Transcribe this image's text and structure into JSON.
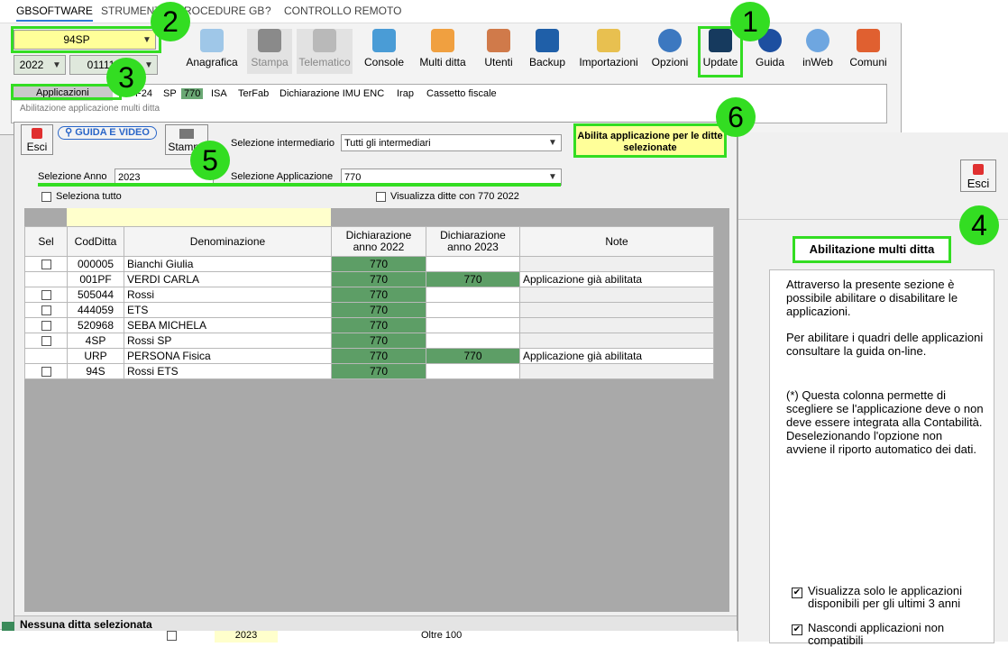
{
  "menu": [
    "GBSOFTWARE",
    "STRUMENTI",
    "PROCEDURE GB",
    "?",
    "CONTROLLO REMOTO"
  ],
  "company_select": "94SP",
  "year_select": "2022",
  "code_select": "011110/",
  "toolbar": [
    {
      "label": "Anagrafica",
      "icon": "user-card-icon",
      "disabled": false
    },
    {
      "label": "Stampa",
      "icon": "printer-icon",
      "disabled": true
    },
    {
      "label": "Telematico",
      "icon": "document-icon",
      "disabled": true
    },
    {
      "label": "Console",
      "icon": "console-icon",
      "disabled": false
    },
    {
      "label": "Multi ditta",
      "icon": "org-chart-icon",
      "disabled": false
    },
    {
      "label": "Utenti",
      "icon": "users-icon",
      "disabled": false
    },
    {
      "label": "Backup",
      "icon": "backup-icon",
      "disabled": false
    },
    {
      "label": "Importazioni",
      "icon": "import-icon",
      "disabled": false
    },
    {
      "label": "Opzioni",
      "icon": "gear-icon",
      "disabled": false
    },
    {
      "label": "Update",
      "icon": "monitor-icon",
      "disabled": false
    },
    {
      "label": "Guida",
      "icon": "help-icon",
      "disabled": false
    },
    {
      "label": "inWeb",
      "icon": "cloud-icon",
      "disabled": false
    },
    {
      "label": "Comuni",
      "icon": "megaphone-icon",
      "disabled": false
    }
  ],
  "nav_tabs": [
    "Applicazioni",
    "F24",
    "SP",
    "770",
    "ISA",
    "TerFab",
    "Dichiarazione IMU ENC",
    "Irap",
    "Cassetto fiscale"
  ],
  "window_caption": "Abilitazione applicazione multi ditta",
  "dialog": {
    "exit_label": "Esci",
    "guide_label": "GUIDA E VIDEO",
    "print_label": "Stampa",
    "intermediary_label": "Selezione intermediario",
    "intermediary_value": "Tutti gli intermediari",
    "enable_button": "Abilita applicazione per le ditte selezionate",
    "year_label": "Selezione Anno",
    "year_value": "2023",
    "app_label": "Selezione Applicazione",
    "app_value": "770",
    "select_all": "Seleziona tutto",
    "show_companies": "Visualizza ditte con 770 2022",
    "columns": [
      "Sel",
      "CodDitta",
      "Denominazione",
      "Dichiarazione anno 2022",
      "Dichiarazione anno 2023",
      "Note"
    ],
    "rows": [
      {
        "sel": true,
        "code": "000005",
        "name": "Bianchi Giulia",
        "y2022": "770",
        "y2023": "",
        "note": ""
      },
      {
        "sel": false,
        "code": "001PF",
        "name": "VERDI CARLA",
        "y2022": "770",
        "y2023": "770",
        "note": "Applicazione già abilitata"
      },
      {
        "sel": true,
        "code": "505044",
        "name": "Rossi",
        "y2022": "770",
        "y2023": "",
        "note": ""
      },
      {
        "sel": true,
        "code": "444059",
        "name": "ETS",
        "y2022": "770",
        "y2023": "",
        "note": ""
      },
      {
        "sel": true,
        "code": "520968",
        "name": "SEBA MICHELA",
        "y2022": "770",
        "y2023": "",
        "note": ""
      },
      {
        "sel": true,
        "code": "4SP",
        "name": "Rossi SP",
        "y2022": "770",
        "y2023": "",
        "note": ""
      },
      {
        "sel": false,
        "code": "URP",
        "name": "PERSONA Fisica",
        "y2022": "770",
        "y2023": "770",
        "note": "Applicazione già abilitata"
      },
      {
        "sel": true,
        "code": "94S",
        "name": "Rossi ETS",
        "y2022": "770",
        "y2023": "",
        "note": ""
      }
    ],
    "status": "Nessuna ditta selezionata"
  },
  "bottom_row": {
    "year": "2023",
    "value": "Oltre 100"
  },
  "help": {
    "exit_label": "Esci",
    "title": "Abilitazione multi ditta",
    "paragraphs": [
      "Attraverso la presente sezione è possibile abilitare o disabilitare le applicazioni.",
      "Per abilitare i quadri delle applicazioni consultare la guida on-line.",
      "(*) Questa colonna permette di scegliere se l'applicazione deve o non deve essere integrata alla Contabilità. Deselezionando l'opzione non avviene il riporto automatico dei dati."
    ],
    "options": [
      {
        "label": "Visualizza solo le applicazioni disponibili per gli ultimi 3 anni",
        "checked": true
      },
      {
        "label": "Nascondi applicazioni non compatibili",
        "checked": true
      }
    ]
  },
  "callouts": [
    "1",
    "2",
    "3",
    "4",
    "5",
    "6"
  ],
  "colors": {
    "highlight": "#33dd22",
    "grid_green": "#5d9e66",
    "pink": "#f08fd0"
  }
}
